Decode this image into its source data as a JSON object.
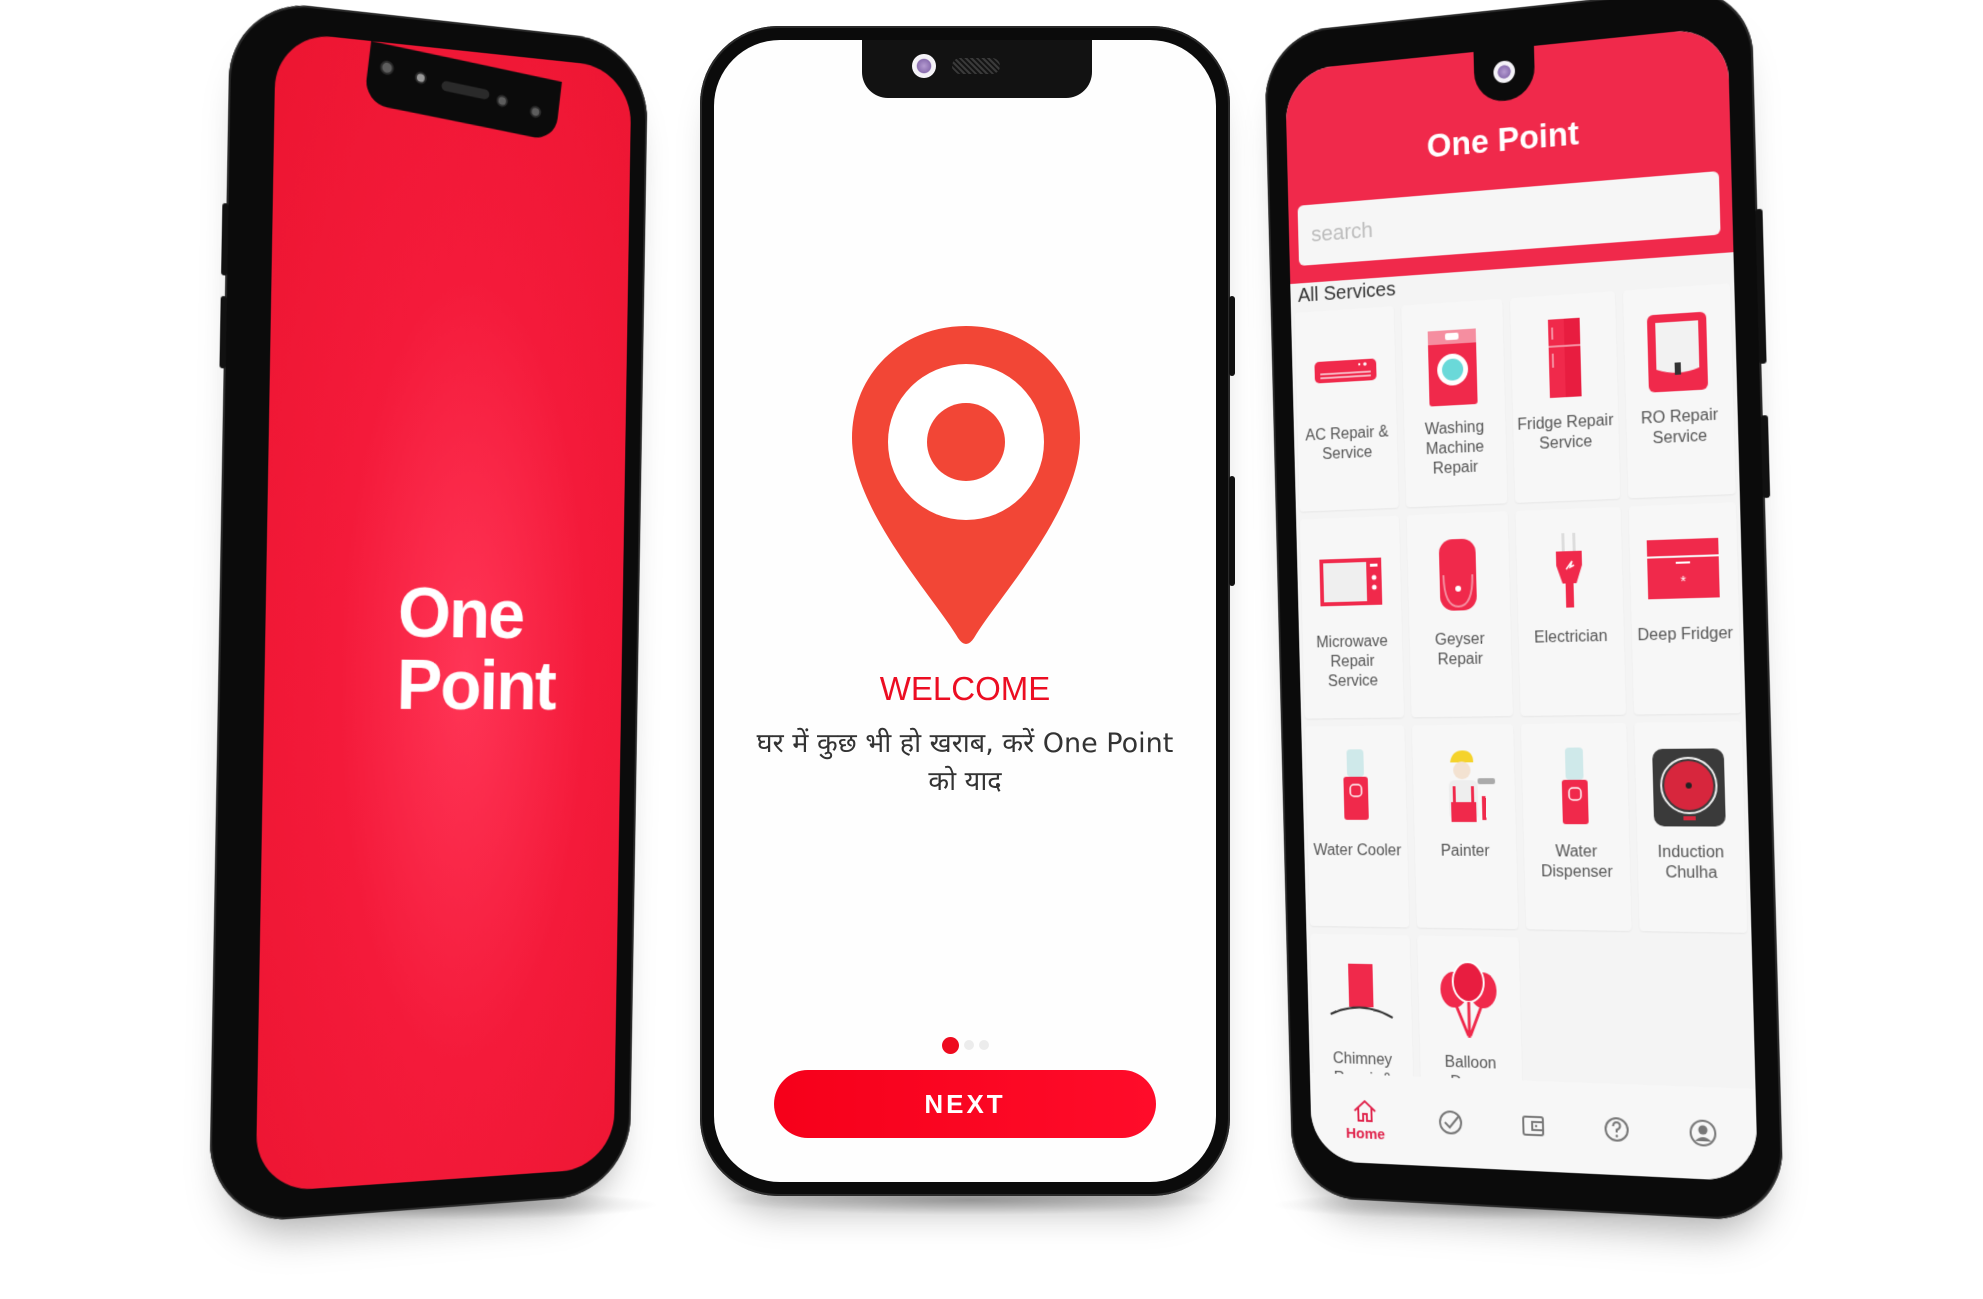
{
  "brand": {
    "name": "One Point",
    "logo_line1": "One",
    "logo_line2": "Point",
    "primary_color": "#f0294b",
    "accent_red": "#ee0b1f",
    "pin_color": "#f24636"
  },
  "splash_screen": {
    "logo_line1": "One",
    "logo_line2": "Point"
  },
  "welcome_screen": {
    "heading": "WELCOME",
    "tagline": "घर में कुछ भी हो खराब, करें One Point को याद",
    "pager": {
      "total": 3,
      "active_index": 0
    },
    "next_button": "NEXT"
  },
  "home_screen": {
    "title": "One Point",
    "search_placeholder": "search",
    "section_label": "All Services",
    "services": [
      {
        "label": "AC Repair & Service",
        "icon": "air-conditioner-icon"
      },
      {
        "label": "Washing Machine Repair",
        "icon": "washing-machine-icon"
      },
      {
        "label": "Fridge Repair Service",
        "icon": "fridge-icon"
      },
      {
        "label": "RO Repair Service",
        "icon": "ro-purifier-icon"
      },
      {
        "label": "Microwave Repair Service",
        "icon": "microwave-icon"
      },
      {
        "label": "Geyser Repair",
        "icon": "geyser-icon"
      },
      {
        "label": "Electrician",
        "icon": "electric-plug-icon"
      },
      {
        "label": "Deep Fridger",
        "icon": "deep-freezer-icon"
      },
      {
        "label": "Water Cooler",
        "icon": "water-cooler-icon"
      },
      {
        "label": "Painter",
        "icon": "painter-icon"
      },
      {
        "label": "Water Dispenser",
        "icon": "water-dispenser-icon"
      },
      {
        "label": "Induction Chulha",
        "icon": "induction-cooktop-icon"
      },
      {
        "label": "Chimney Repair & Service",
        "icon": "chimney-icon"
      },
      {
        "label": "Balloon Decor",
        "icon": "balloons-icon"
      }
    ],
    "bottom_nav": [
      {
        "label": "Home",
        "icon": "home-icon",
        "active": true
      },
      {
        "label": "",
        "icon": "check-circle-icon",
        "active": false
      },
      {
        "label": "",
        "icon": "wallet-icon",
        "active": false
      },
      {
        "label": "",
        "icon": "help-circle-icon",
        "active": false
      },
      {
        "label": "",
        "icon": "profile-icon",
        "active": false
      }
    ]
  }
}
